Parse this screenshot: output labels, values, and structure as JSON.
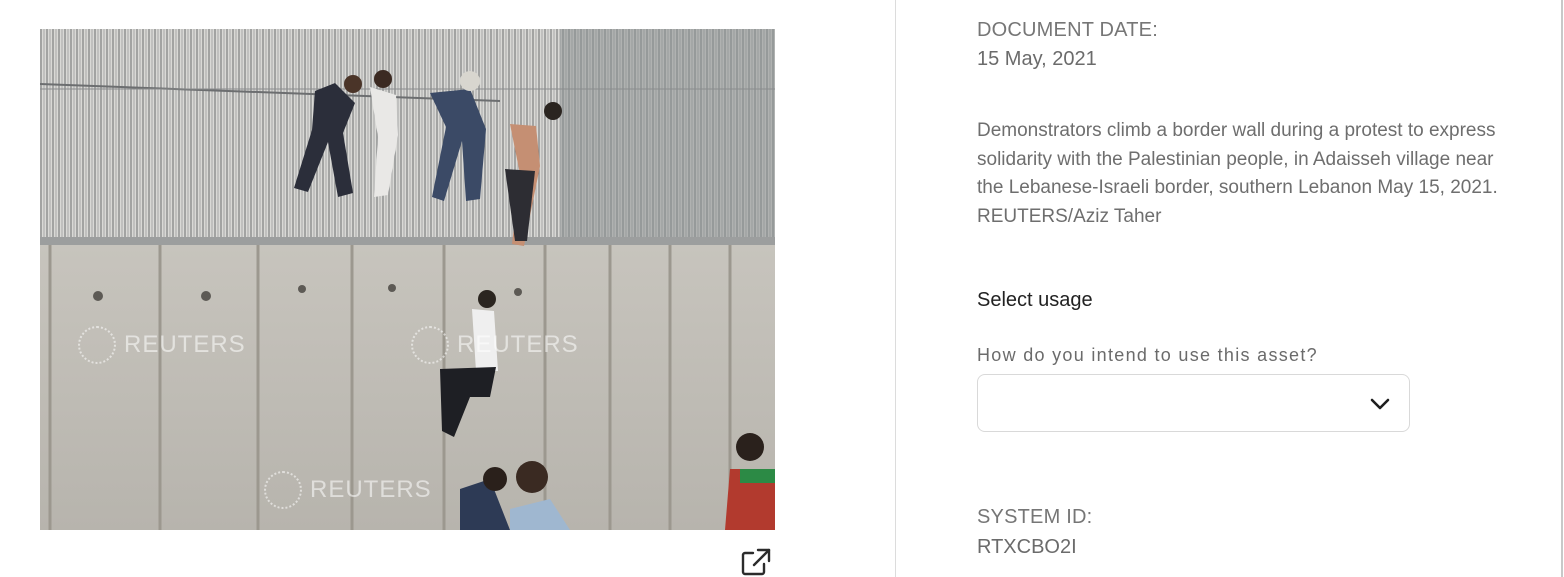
{
  "photo": {
    "watermark_text": "REUTERS",
    "alt": "Demonstrators climb a border wall"
  },
  "icons": {
    "external_link": "external-link-icon",
    "chevron": "chevron-down-icon"
  },
  "metadata": {
    "document_date_label": "DOCUMENT DATE:",
    "document_date_value": "15 May, 2021",
    "caption": "Demonstrators climb a border wall during a protest to express solidarity with the Palestinian people, in Adaisseh village near the Lebanese-Israeli border, southern Lebanon May 15, 2021. REUTERS/Aziz Taher",
    "select_usage_title": "Select usage",
    "usage_question": "How do you intend to use this asset?",
    "usage_selected": "",
    "system_id_label": "SYSTEM ID:",
    "system_id_value": "RTXCBO2I"
  },
  "colors": {
    "divider": "#dcdcdc",
    "label": "#767676",
    "title": "#222222"
  }
}
